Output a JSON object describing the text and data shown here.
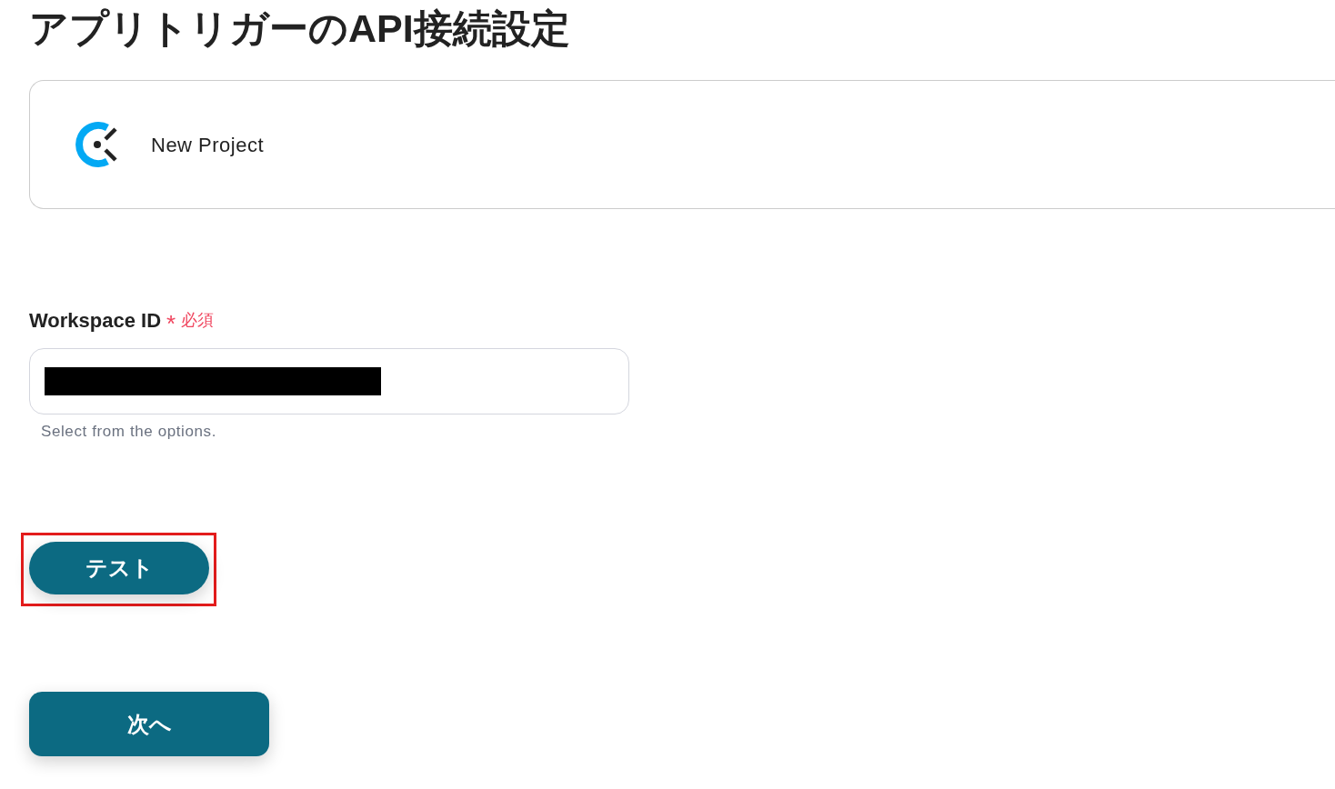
{
  "page": {
    "title": "アプリトリガーのAPI接続設定"
  },
  "app_card": {
    "name": "New Project"
  },
  "field": {
    "label": "Workspace ID",
    "required": true,
    "required_mark": "*",
    "required_label": "必須",
    "value_redacted": true,
    "hint": "Select from the options."
  },
  "buttons": [
    {
      "label": "テスト",
      "kind": "pill",
      "highlighted": true
    },
    {
      "label": "次へ",
      "kind": "rounded",
      "highlighted": false
    }
  ]
}
